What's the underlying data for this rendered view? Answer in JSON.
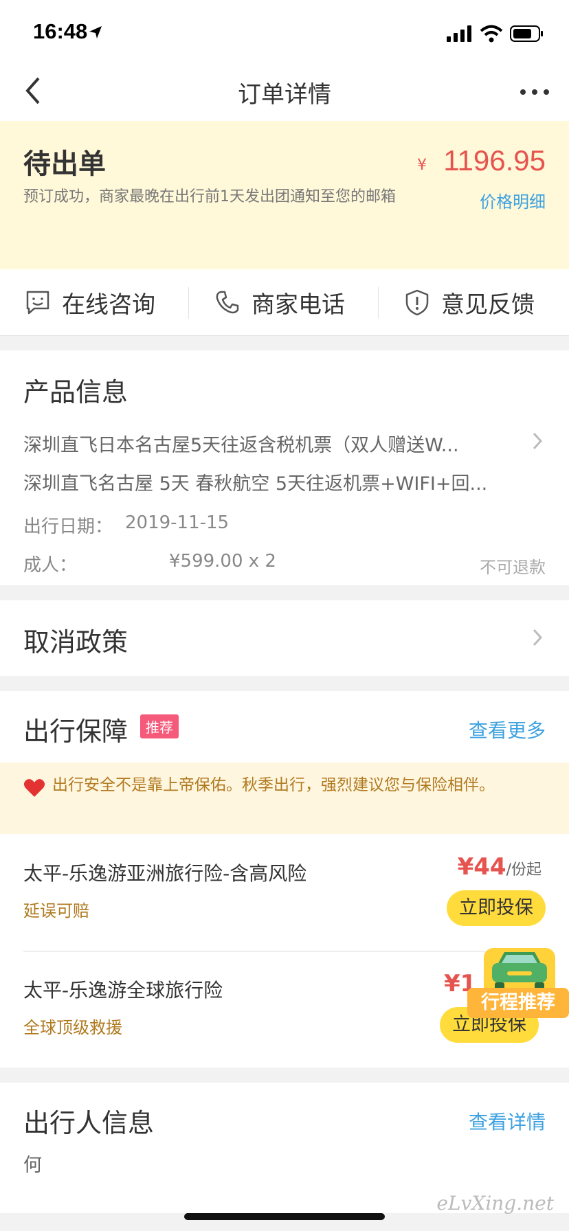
{
  "status_bar": {
    "time": "16:48"
  },
  "nav": {
    "title": "订单详情"
  },
  "order_status": {
    "title": "待出单",
    "description": "预订成功，商家最晚在出行前1天发出团通知至您的邮箱",
    "currency": "¥",
    "price": "1196.95",
    "price_detail_link": "价格明细"
  },
  "actions": [
    {
      "label": "在线咨询",
      "icon": "chat-icon"
    },
    {
      "label": "商家电话",
      "icon": "phone-icon"
    },
    {
      "label": "意见反馈",
      "icon": "feedback-icon"
    }
  ],
  "product": {
    "section_title": "产品信息",
    "name": "深圳直飞日本名古屋5天往返含税机票（双人赠送W...",
    "subtitle": "深圳直飞名古屋 5天 春秋航空 5天往返机票+WIFI+回...",
    "date_label": "出行日期：",
    "date_value": "2019-11-15",
    "adult_label": "成人：",
    "adult_price": "¥599.00 x 2",
    "refund_status": "不可退款"
  },
  "cancel_policy": {
    "title": "取消政策"
  },
  "travel_insurance": {
    "section_title": "出行保障",
    "tag": "推荐",
    "more_link": "查看更多",
    "notice": "出行安全不是靠上帝保佑。秋季出行，强烈建议您与保险相伴。",
    "items": [
      {
        "name": "太平-乐逸游亚洲旅行险-含高风险",
        "feature": "延误可赔",
        "price": "¥44",
        "unit": "/份起",
        "button": "立即投保"
      },
      {
        "name": "太平-乐逸游全球旅行险",
        "feature": "全球顶级救援",
        "price": "¥1",
        "unit": "",
        "button": "立即投保"
      }
    ]
  },
  "float_badge": {
    "label": "行程推荐"
  },
  "traveler": {
    "section_title": "出行人信息",
    "detail_link": "查看详情",
    "first_char": "何"
  },
  "watermark": "eLvXing.net",
  "colors": {
    "accent_red": "#e6544f",
    "link_blue": "#3ea2e0",
    "status_bg": "#fff8d9",
    "button_yellow": "#ffdc3c"
  }
}
